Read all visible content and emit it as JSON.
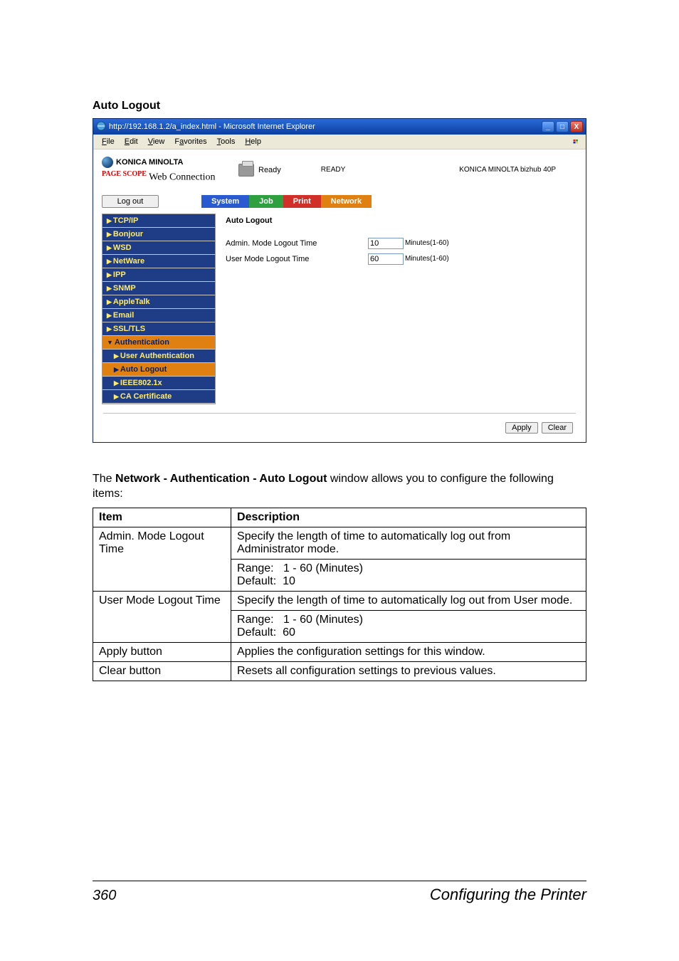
{
  "section_title": "Auto Logout",
  "window": {
    "title": "http://192.168.1.2/a_index.html - Microsoft Internet Explorer",
    "menu": {
      "file": "File",
      "edit": "Edit",
      "view": "View",
      "favorites": "Favorites",
      "tools": "Tools",
      "help": "Help"
    },
    "controls": {
      "min": "_",
      "max": "□",
      "close": "X"
    }
  },
  "header": {
    "brand": "KONICA MINOLTA",
    "sub_prefix": "PAGE SCOPE",
    "sub": "Web Connection",
    "status_text": "Ready",
    "status_label": "READY",
    "model": "KONICA MINOLTA bizhub 40P"
  },
  "toolbar": {
    "logout": "Log out",
    "tabs": {
      "system": "System",
      "job": "Job",
      "print": "Print",
      "network": "Network"
    }
  },
  "sidebar": {
    "items": [
      {
        "label": "TCP/IP"
      },
      {
        "label": "Bonjour"
      },
      {
        "label": "WSD"
      },
      {
        "label": "NetWare"
      },
      {
        "label": "IPP"
      },
      {
        "label": "SNMP"
      },
      {
        "label": "AppleTalk"
      },
      {
        "label": "Email"
      },
      {
        "label": "SSL/TLS"
      },
      {
        "label": "Authentication",
        "selected": true
      },
      {
        "label": "User Authentication",
        "sub": true
      },
      {
        "label": "Auto Logout",
        "sub": true,
        "selected": true
      },
      {
        "label": "IEEE802.1x",
        "sub": true
      },
      {
        "label": "CA Certificate",
        "sub": true
      }
    ]
  },
  "form": {
    "title": "Auto Logout",
    "rows": [
      {
        "label": "Admin. Mode Logout Time",
        "value": "10",
        "unit": "Minutes(1-60)"
      },
      {
        "label": "User Mode Logout Time",
        "value": "60",
        "unit": "Minutes(1-60)"
      }
    ],
    "apply": "Apply",
    "clear": "Clear"
  },
  "body_text_pre": "The ",
  "body_text_bold": "Network - Authentication - Auto Logout",
  "body_text_post": " window allows you to configure the following items:",
  "table": {
    "head": {
      "item": "Item",
      "desc": "Description"
    },
    "rows": [
      {
        "item": "Admin. Mode Logout Time",
        "desc1": "Specify the length of time to automatically log out from Administrator mode.",
        "desc2": "Range:   1 - 60 (Minutes)\nDefault:  10"
      },
      {
        "item": "User Mode Logout Time",
        "desc1": "Specify the length of time to automatically log out from User mode.",
        "desc2": "Range:   1 - 60 (Minutes)\nDefault:  60"
      },
      {
        "item": "Apply button",
        "desc1": "Applies the configuration settings for this window."
      },
      {
        "item": "Clear button",
        "desc1": "Resets all configuration settings to previous values."
      }
    ]
  },
  "footer": {
    "page": "360",
    "text": "Configuring the Printer"
  }
}
